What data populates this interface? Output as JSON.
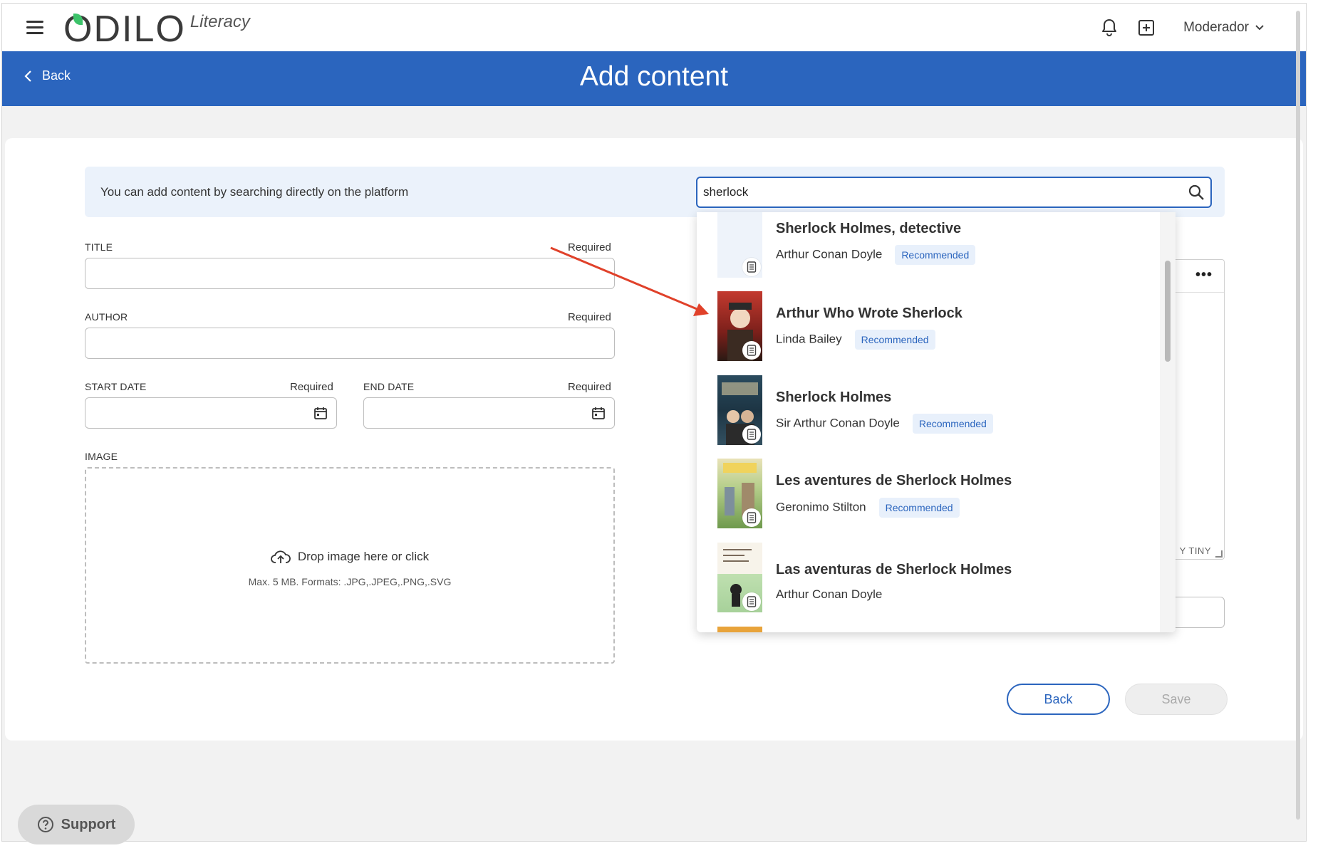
{
  "brand": {
    "logo": "ODILO",
    "sub": "Literacy"
  },
  "topbar": {
    "user_label": "Moderador"
  },
  "header": {
    "back_label": "Back",
    "title": "Add content"
  },
  "search": {
    "banner_text": "You can add content by searching directly on the platform",
    "query": "sherlock"
  },
  "form": {
    "title_label": "TITLE",
    "author_label": "AUTHOR",
    "start_date_label": "START DATE",
    "end_date_label": "END DATE",
    "image_label": "IMAGE",
    "required": "Required",
    "drop_text": "Drop image here or click",
    "drop_hint": "Max. 5 MB. Formats: .JPG,.JPEG,.PNG,.SVG"
  },
  "editor": {
    "brand_text": "Y TINY"
  },
  "actions": {
    "back_label": "Back",
    "save_label": "Save"
  },
  "results": [
    {
      "title": "Sherlock Holmes, detective",
      "author": "Arthur Conan Doyle",
      "badge": "Recommended",
      "cover_color": "#eef3fa"
    },
    {
      "title": "Arthur Who Wrote Sherlock",
      "author": "Linda Bailey",
      "badge": "Recommended",
      "cover_color": "#b8342c"
    },
    {
      "title": "Sherlock Holmes",
      "author": "Sir Arthur Conan Doyle",
      "badge": "Recommended",
      "cover_color": "#1e3b4a"
    },
    {
      "title": "Les aventures de Sherlock Holmes",
      "author": "Geronimo Stilton",
      "badge": "Recommended",
      "cover_color": "#8fae5c"
    },
    {
      "title": "Las aventuras de Sherlock Holmes",
      "author": "Arthur Conan Doyle",
      "badge": "",
      "cover_color": "#cfe3c4"
    }
  ],
  "support": {
    "label": "Support"
  },
  "colors": {
    "primary": "#2b65be",
    "badge_bg": "#e8f0fb",
    "annotation": "#e0412a"
  }
}
